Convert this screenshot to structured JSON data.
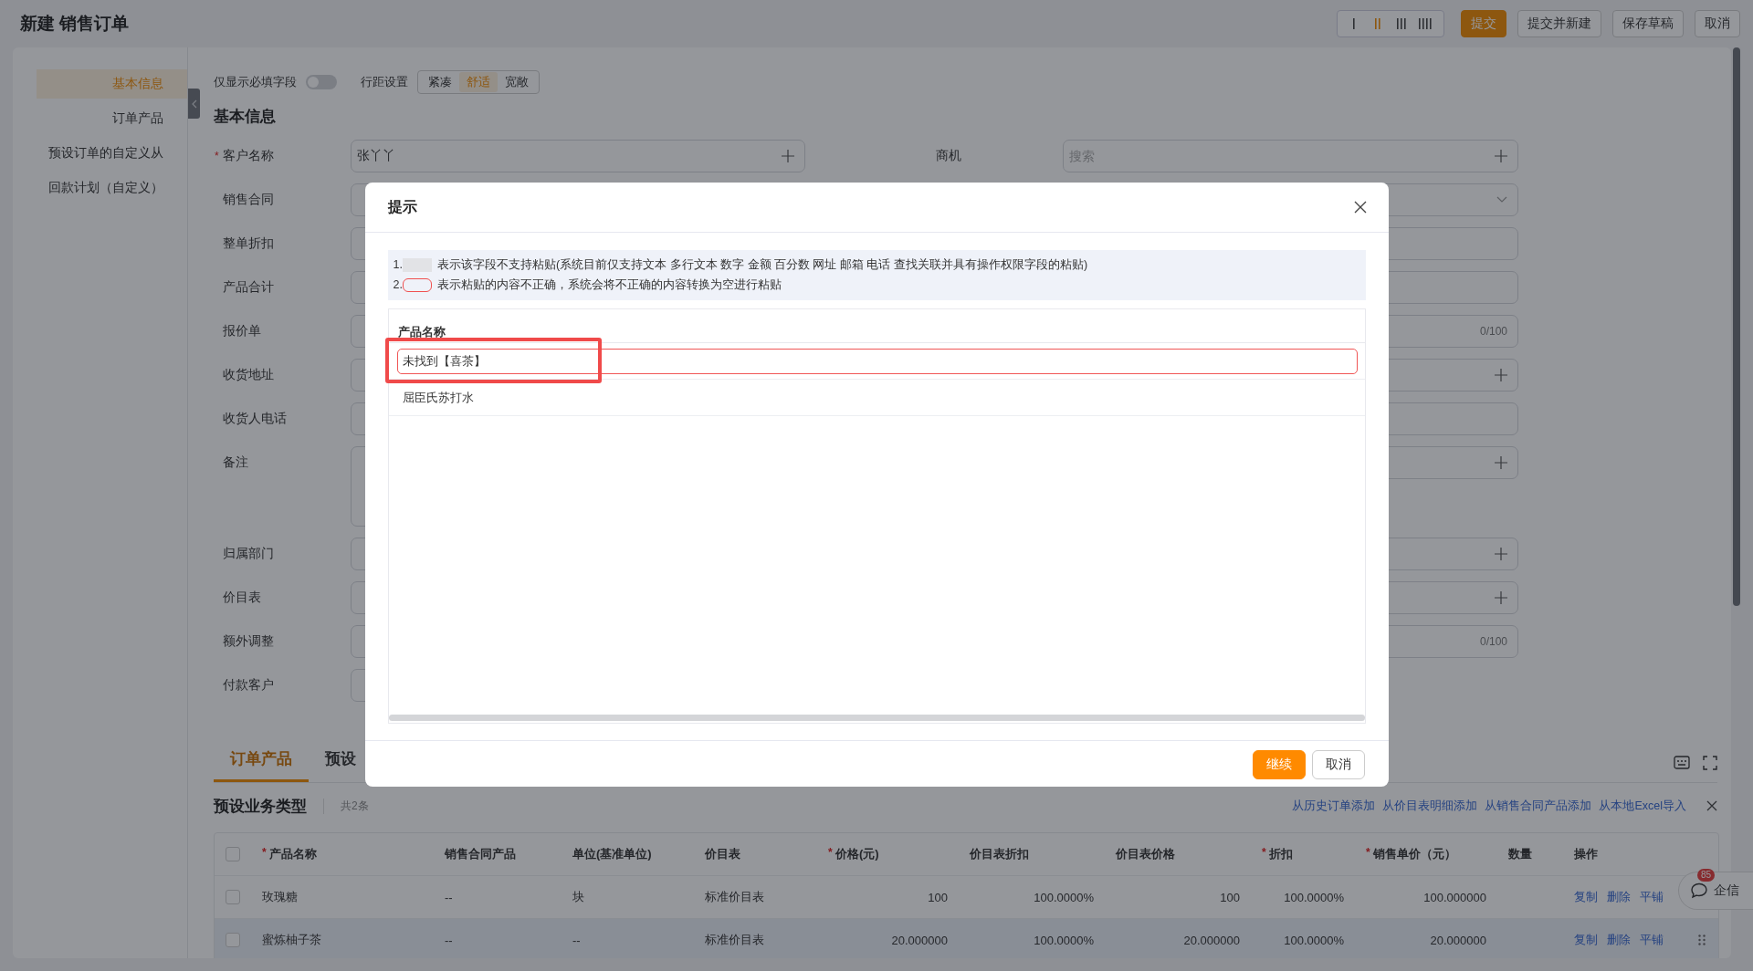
{
  "header": {
    "title": "新建 销售订单",
    "density": [
      {
        "selected": false
      },
      {
        "selected": true
      },
      {
        "selected": false
      },
      {
        "selected": false
      }
    ],
    "buttons": [
      {
        "label": "提交",
        "kind": "primary"
      },
      {
        "label": "提交并新建",
        "kind": "default"
      },
      {
        "label": "保存草稿",
        "kind": "default"
      },
      {
        "label": "取消",
        "kind": "default"
      }
    ]
  },
  "nav": [
    {
      "label": "基本信息",
      "selected": true
    },
    {
      "label": "订单产品",
      "selected": false
    },
    {
      "label": "预设订单的自定义从",
      "selected": false
    },
    {
      "label": "回款计划（自定义）",
      "selected": false
    }
  ],
  "toolbar": {
    "required_only": {
      "label": "仅显示必填字段",
      "on": false
    },
    "spacing": {
      "label": "行距设置",
      "options": [
        {
          "label": "紧凑",
          "selected": false
        },
        {
          "label": "舒适",
          "selected": true
        },
        {
          "label": "宽敞",
          "selected": false
        }
      ]
    }
  },
  "section_title": "基本信息",
  "form_rows": [
    {
      "left": {
        "label": "客户名称",
        "mark": "*",
        "value": "张丫丫",
        "kind": "lookup"
      },
      "right": {
        "label": "商机",
        "placeholder": "搜索",
        "kind": "lookup"
      }
    },
    {
      "left": {
        "label": "销售合同",
        "kind": "text"
      },
      "right": {
        "kind": "select"
      }
    },
    {
      "left": {
        "label": "整单折扣",
        "kind": "text"
      },
      "right": {
        "kind": "text"
      }
    },
    {
      "left": {
        "label": "产品合计",
        "kind": "text"
      },
      "right": {
        "kind": "text"
      }
    },
    {
      "left": {
        "label": "报价单",
        "kind": "text"
      },
      "right": {
        "kind": "counter",
        "counter": "0/100"
      }
    },
    {
      "left": {
        "label": "收货地址",
        "kind": "text"
      },
      "right": {
        "kind": "lookup"
      }
    },
    {
      "left": {
        "label": "收货人电话",
        "kind": "text"
      },
      "right": {
        "kind": "text"
      }
    },
    {
      "left": {
        "label": "备注",
        "kind": "textarea"
      },
      "right": {
        "kind": "lookup"
      }
    },
    {
      "left": {
        "label": "归属部门",
        "kind": "text"
      },
      "right": {
        "kind": "lookup"
      }
    },
    {
      "left": {
        "label": "价目表",
        "kind": "text"
      },
      "right": {
        "kind": "lookup"
      }
    },
    {
      "left": {
        "label": "额外调整",
        "kind": "text"
      },
      "right": {
        "kind": "counter",
        "counter": "0/100"
      }
    },
    {
      "left": {
        "label": "付款客户",
        "kind": "text"
      }
    }
  ],
  "bottom_tabs": [
    {
      "label": "订单产品",
      "selected": true
    },
    {
      "label": "预设",
      "selected": false
    }
  ],
  "products": {
    "title": "预设业务类型",
    "count": "共2条",
    "actions": [
      "从历史订单添加",
      "从价目表明细添加",
      "从销售合同产品添加",
      "从本地Excel导入"
    ],
    "header_checked": false,
    "columns": [
      {
        "label": "产品名称",
        "mark": "*",
        "kind": "text"
      },
      {
        "label": "销售合同产品",
        "kind": "text"
      },
      {
        "label": "单位(基准单位)",
        "kind": "text"
      },
      {
        "label": "价目表",
        "kind": "text"
      },
      {
        "label": "价格(元)",
        "mark": "*",
        "kind": "number"
      },
      {
        "label": "价目表折扣",
        "kind": "number"
      },
      {
        "label": "价目表价格",
        "kind": "number"
      },
      {
        "label": "折扣",
        "mark": "*",
        "kind": "number"
      },
      {
        "label": "销售单价（元）",
        "mark": "*",
        "kind": "number"
      },
      {
        "label": "数量",
        "kind": "text"
      },
      {
        "label": "操作",
        "kind": "text"
      }
    ],
    "rows": [
      {
        "checked": false,
        "handle": false,
        "cells": [
          "玫瑰糖",
          "--",
          "块",
          "标准价目表",
          "100",
          "100.0000%",
          "100",
          "100.0000%",
          "100.000000",
          ""
        ],
        "actions": [
          "复制",
          "删除",
          "平铺"
        ]
      },
      {
        "checked": false,
        "handle": true,
        "cells": [
          "蜜炼柚子茶",
          "--",
          "--",
          "标准价目表",
          "20.000000",
          "100.0000%",
          "20.000000",
          "100.0000%",
          "20.000000",
          ""
        ],
        "actions": [
          "复制",
          "删除",
          "平铺"
        ]
      }
    ]
  },
  "chat": {
    "label": "企信",
    "badge": "85"
  },
  "modal": {
    "title": "提示",
    "notes": [
      {
        "index": "1.",
        "kind": "unsupported",
        "text": "表示该字段不支持粘贴(系统目前仅支持文本 多行文本 数字 金额 百分数 网址 邮箱 电话 查找关联并具有操作权限字段的粘贴)"
      },
      {
        "index": "2.",
        "kind": "invalid",
        "text": "表示粘贴的内容不正确，系统会将不正确的内容转换为空进行粘贴"
      }
    ],
    "column": "产品名称",
    "rows": [
      {
        "value": "未找到【喜茶】",
        "invalid": true,
        "annotated": true
      },
      {
        "value": "屈臣氏苏打水",
        "invalid": false,
        "annotated": false
      }
    ],
    "buttons": [
      {
        "label": "继续",
        "kind": "primary"
      },
      {
        "label": "取消",
        "kind": "default"
      }
    ]
  }
}
